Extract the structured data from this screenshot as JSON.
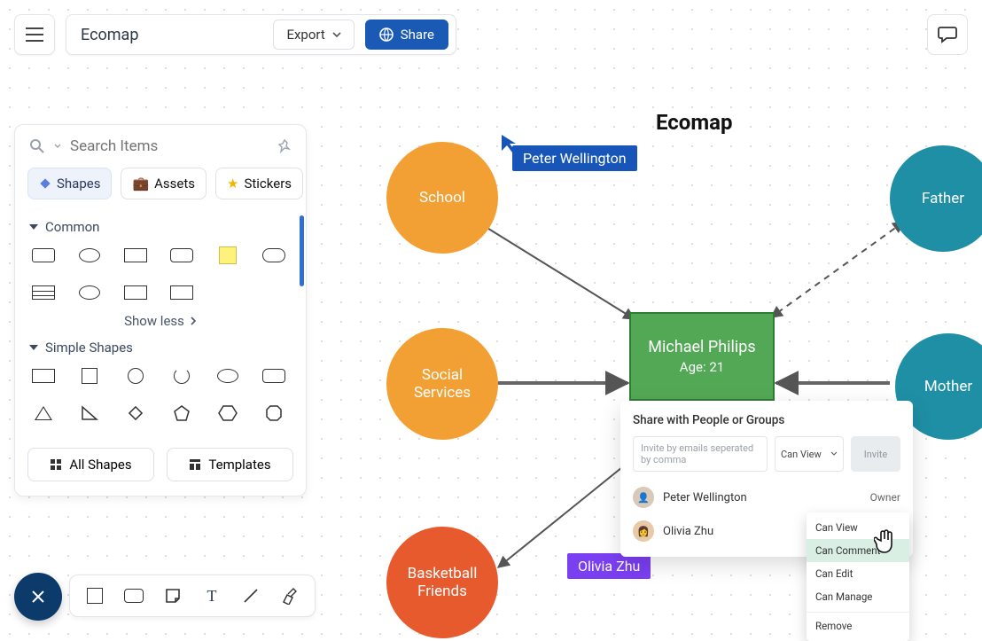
{
  "doc": {
    "title": "Ecomap"
  },
  "toolbar": {
    "export": "Export",
    "share": "Share"
  },
  "panel": {
    "search_placeholder": "Search Items",
    "tabs": {
      "shapes": "Shapes",
      "assets": "Assets",
      "stickers": "Stickers"
    },
    "sections": {
      "common": "Common",
      "simple": "Simple Shapes"
    },
    "show_less": "Show less",
    "all_shapes": "All Shapes",
    "templates": "Templates"
  },
  "canvas": {
    "title": "Ecomap",
    "nodes": {
      "school": "School",
      "social": "Social\nServices",
      "basketball": "Basketball\nFriends",
      "father": "Father",
      "mother": "Mother",
      "center_name": "Michael Philips",
      "center_sub": "Age: 21"
    },
    "cursors": {
      "peter": "Peter Wellington",
      "olivia": "Olivia Zhu"
    }
  },
  "share": {
    "title": "Share with People or Groups",
    "placeholder": "Invite by emails seperated by comma",
    "default_perm": "Can View",
    "invite": "Invite",
    "users": [
      {
        "name": "Peter Wellington",
        "role": "Owner"
      },
      {
        "name": "Olivia Zhu",
        "role": "Can Comment"
      }
    ],
    "perm_options": [
      "Can View",
      "Can Comment",
      "Can Edit",
      "Can Manage",
      "Remove"
    ]
  }
}
